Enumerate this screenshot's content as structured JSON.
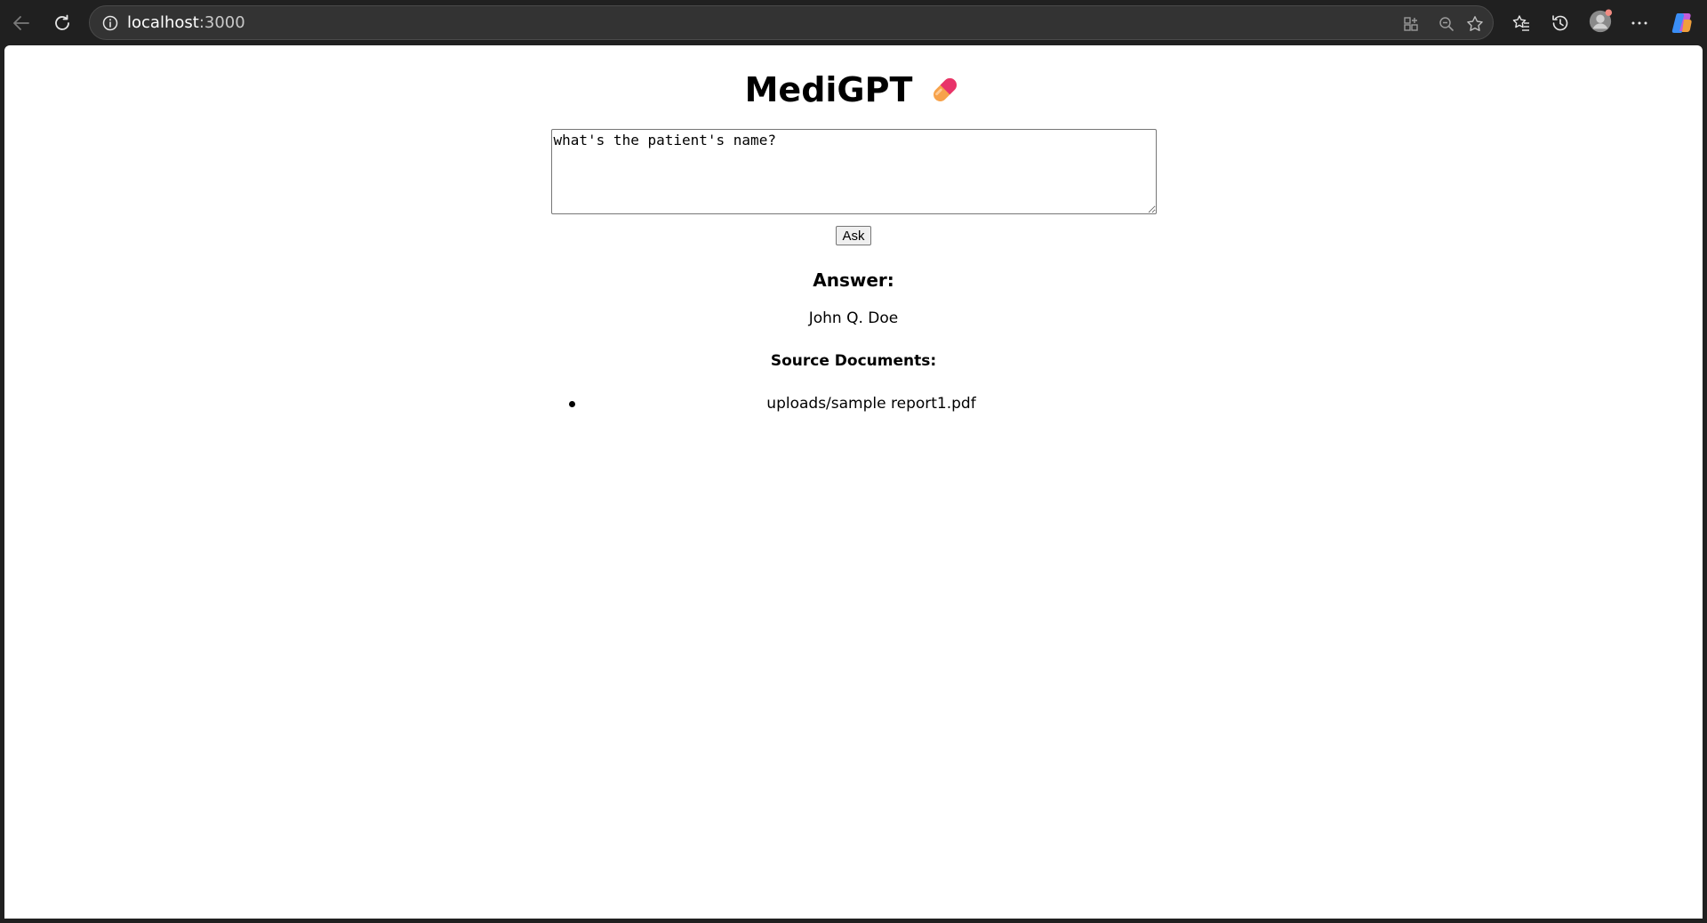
{
  "browser": {
    "url_host": "localhost",
    "url_port": ":3000",
    "icons": {
      "back": "back-arrow-icon",
      "reload": "reload-icon",
      "site_info": "info-icon",
      "app_available": "app-available-icon",
      "zoom": "zoom-out-icon",
      "favorite": "star-icon",
      "favorites": "favorites-icon",
      "history": "history-icon",
      "profile": "profile-avatar",
      "more": "more-icon",
      "copilot": "copilot-icon"
    }
  },
  "app": {
    "title": "MediGPT",
    "title_emoji": "pill-icon",
    "question_value": "what's the patient's name?",
    "ask_label": "Ask",
    "answer_heading": "Answer:",
    "answer_text": "John Q. Doe",
    "sources_heading": "Source Documents:",
    "sources": [
      "uploads/sample report1.pdf"
    ]
  },
  "colors": {
    "chrome_bg": "#202020",
    "address_bg": "#333333",
    "page_bg": "#ffffff",
    "pill_pink": "#e8336a",
    "pill_orange": "#f7a24a",
    "notification_dot": "#f28b82"
  }
}
